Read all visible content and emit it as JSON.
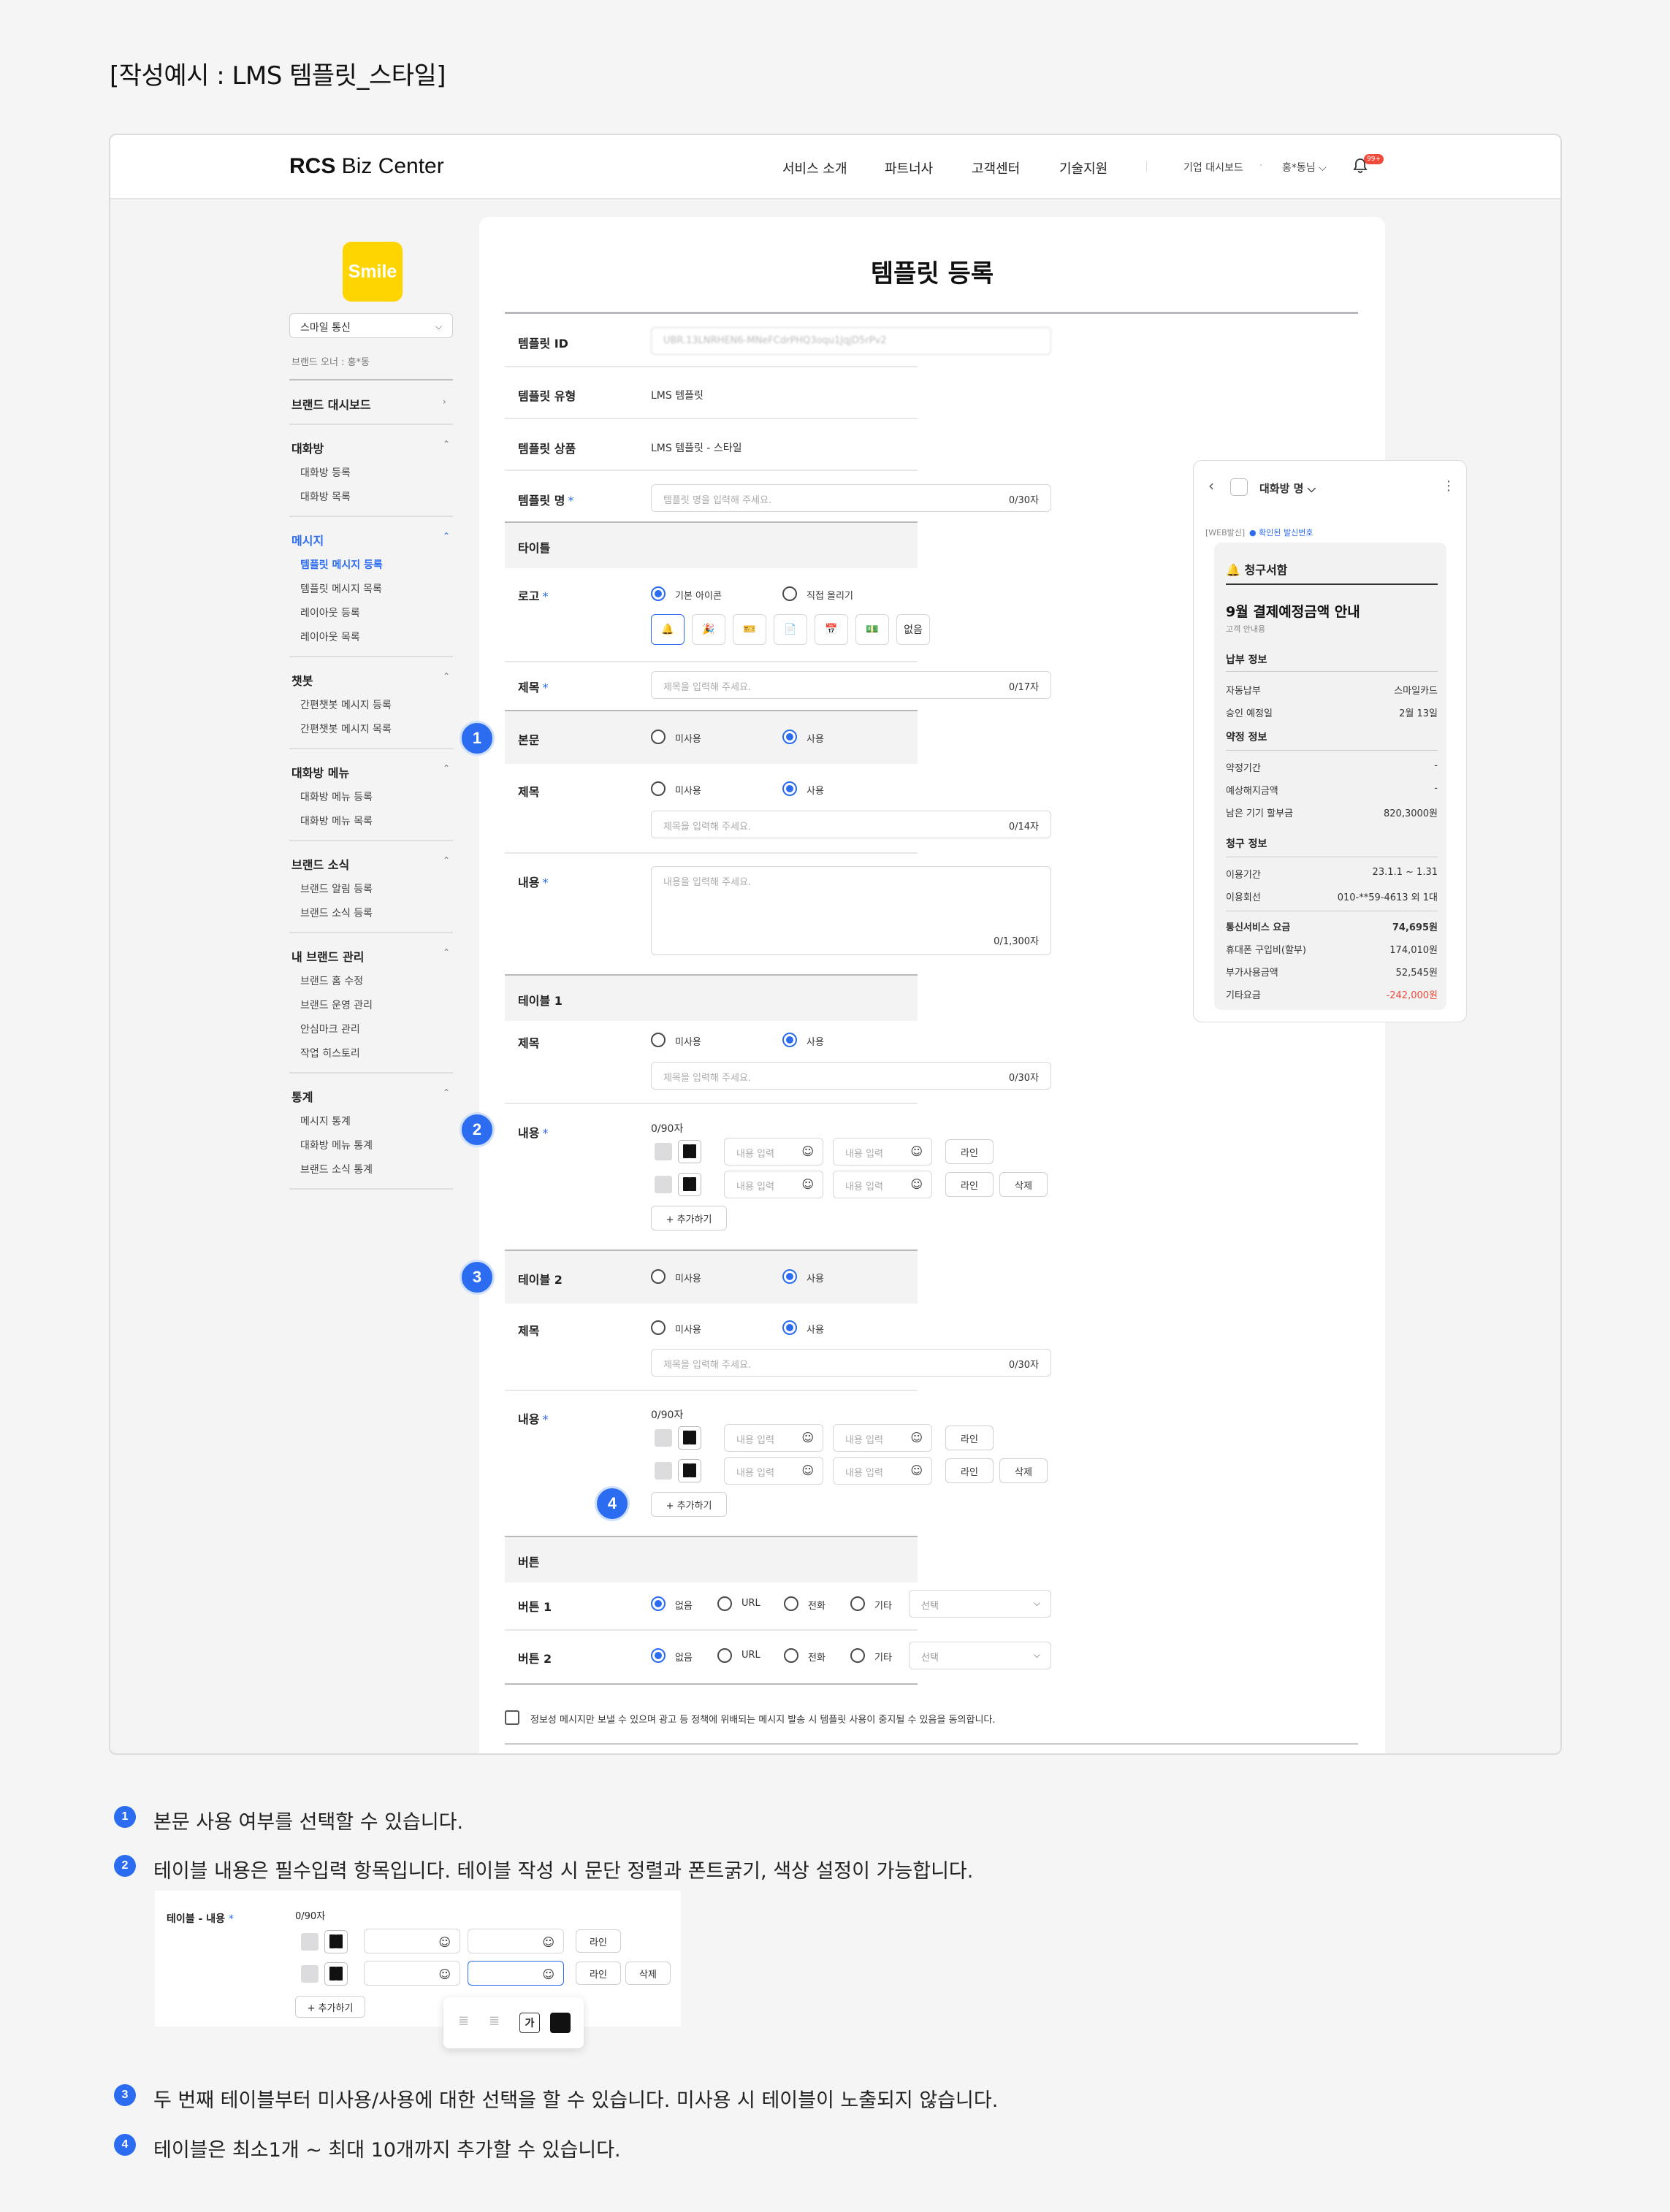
{
  "page_title": "[작성예시 : LMS 템플릿_스타일]",
  "gnb": {
    "logo_bold": "RCS",
    "logo_rest": " Biz Center",
    "nav": [
      "서비스 소개",
      "파트너사",
      "고객센터",
      "기술지원"
    ],
    "dashboard": "기업 대시보드",
    "user": "홍*동님",
    "bell_badge": "99+"
  },
  "sidebar": {
    "brand_logo_text": "Smile",
    "brand_select": "스마일 통신",
    "brand_owner": "브랜드 오너 : 홍*동",
    "dashboard": "브랜드 대시보드",
    "groups": [
      {
        "title": "대화방",
        "items": [
          "대화방 등록",
          "대화방 목록"
        ]
      },
      {
        "title": "메시지",
        "items": [
          "템플릿 메시지 등록",
          "템플릿 메시지 목록",
          "레이아웃 등록",
          "레이아웃 목록"
        ]
      },
      {
        "title": "챗봇",
        "items": [
          "간편챗봇 메시지 등록",
          "간편챗봇 메시지 목록"
        ]
      },
      {
        "title": "대화방 메뉴",
        "items": [
          "대화방 메뉴 등록",
          "대화방 메뉴 목록"
        ]
      },
      {
        "title": "브랜드 소식",
        "items": [
          "브랜드 알림 등록",
          "브랜드 소식 등록"
        ]
      },
      {
        "title": "내 브랜드 관리",
        "items": [
          "브랜드 홈 수정",
          "브랜드 운영 관리",
          "안심마크 관리",
          "작업 히스토리"
        ]
      },
      {
        "title": "통계",
        "items": [
          "메시지 통계",
          "대화방 메뉴 통계",
          "브랜드 소식 통계"
        ]
      }
    ]
  },
  "form": {
    "title": "템플릿 등록",
    "template_id_label": "템플릿 ID",
    "template_id_value": "UBR.13LNRHEN6-MNeFCdrPHQ3oqu1JqjD5rPv2",
    "type_label": "템플릿 유형",
    "type_value": "LMS 템플릿",
    "product_label": "템플릿 상품",
    "product_value": "LMS 템플릿 - 스타일",
    "name_label": "템플릿 명",
    "name_placeholder": "템플릿 명을 입력해 주세요.",
    "name_count": "0/30자",
    "title_section": "타이틀",
    "logo_label": "로고",
    "logo_opt1": "기본 아이콘",
    "logo_opt2": "직접 올리기",
    "logo_none": "없음",
    "subject_label": "제목",
    "subject_placeholder": "제목을 입력해 주세요.",
    "subject_count": "0/17자",
    "body_label": "본문",
    "unused": "미사용",
    "used": "사용",
    "body_subject_label": "제목",
    "body_subject_count": "0/14자",
    "content_label": "내용",
    "content_placeholder": "내용을 입력해 주세요.",
    "content_count": "0/1,300자",
    "table1_label": "테이블 1",
    "table_subject_label": "제목",
    "table_subject_count": "0/30자",
    "table_content_label": "내용",
    "table_content_count": "0/90자",
    "cell_placeholder": "내용 입력",
    "line_btn": "라인",
    "delete_btn": "삭제",
    "add_btn": "+ 추가하기",
    "table2_label": "테이블 2",
    "button_section": "버튼",
    "button1_label": "버튼 1",
    "button2_label": "버튼 2",
    "btn_opt_none": "없음",
    "btn_opt_url": "URL",
    "btn_opt_phone": "전화",
    "btn_opt_etc": "기타",
    "btn_select": "선택",
    "agree_text": "정보성 메시지만 보낼 수 있으며 광고 등 정책에 위배되는 메시지 발송 시 템플릿 사용이 중지될 수 있음을 동의합니다."
  },
  "preview": {
    "room_name": "대화방 명",
    "sender_tag": "[WEB발신]",
    "verified": "확인된 발신번호",
    "header": "청구서함",
    "title": "9월 결제예정금액 안내",
    "subtitle": "고객 안내용",
    "sec1": "납부 정보",
    "rows1": [
      [
        "자동납부",
        "스마일카드"
      ],
      [
        "승인 예정일",
        "2월 13일"
      ]
    ],
    "sec2": "약정 정보",
    "rows2": [
      [
        "약정기간",
        "-"
      ],
      [
        "예상해지금액",
        "-"
      ],
      [
        "남은 기기 할부금",
        "820,3000원"
      ]
    ],
    "sec3": "청구 정보",
    "rows3": [
      [
        "이용기간",
        "23.1.1 ~ 1.31"
      ],
      [
        "이용회선",
        "010-**59-4613 외 1대"
      ]
    ],
    "total_label": "통신서비스 요금",
    "total_value": "74,695원",
    "rows4": [
      [
        "휴대폰 구입비(할부)",
        "174,010원"
      ],
      [
        "부가사용금액",
        "52,545원"
      ],
      [
        "기타요금",
        "-242,000원"
      ]
    ],
    "negative_color": "#f04a3a"
  },
  "notes": [
    {
      "n": "1",
      "text": "본문 사용 여부를 선택할 수 있습니다."
    },
    {
      "n": "2",
      "text": "테이블 내용은 필수입력 항목입니다. 테이블 작성 시 문단 정렬과 폰트굵기, 색상 설정이 가능합니다."
    },
    {
      "n": "3",
      "text": "두 번째 테이블부터 미사용/사용에 대한 선택을 할 수 있습니다. 미사용 시 테이블이 노출되지 않습니다."
    },
    {
      "n": "4",
      "text": "테이블은 최소1개 ~ 최대 10개까지 추가할 수 있습니다."
    }
  ],
  "zoom": {
    "label": "테이블 - 내용",
    "count": "0/90자",
    "line_btn": "라인",
    "delete_btn": "삭제",
    "add_btn": "+ 추가하기",
    "bold_glyph": "가"
  },
  "accent_color": "#2b6cf0"
}
